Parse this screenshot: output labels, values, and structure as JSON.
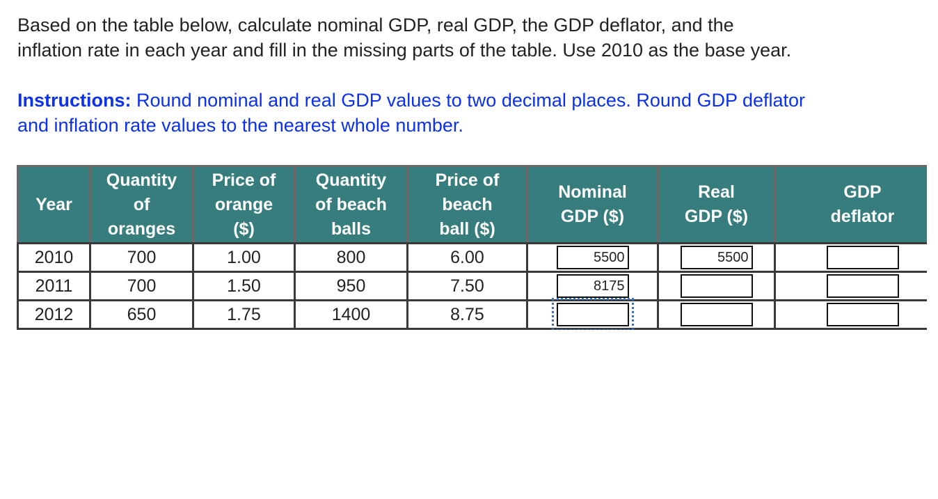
{
  "question": {
    "line1": "Based on the table below, calculate nominal GDP, real GDP, the GDP deflator, and the",
    "line2": "inflation rate in each year and fill in the missing parts of the table. Use 2010 as the base year."
  },
  "instructions": {
    "label": "Instructions:",
    "line1": " Round nominal and real GDP values to two decimal places. Round GDP deflator",
    "line2": "and inflation rate values to the nearest whole number."
  },
  "colors": {
    "header_bg": "#387d7e",
    "instruction_text": "#0b30f0",
    "focus_outline": "#3d72b8"
  },
  "table": {
    "headers": [
      [
        "Year"
      ],
      [
        "Quantity",
        "of",
        "oranges"
      ],
      [
        "Price of",
        "orange",
        "($)"
      ],
      [
        "Quantity",
        "of beach",
        "balls"
      ],
      [
        "Price of",
        "beach",
        "ball ($)"
      ],
      [
        "Nominal",
        "GDP ($)"
      ],
      [
        "Real",
        "GDP ($)"
      ],
      [
        "GDP",
        "deflator"
      ]
    ],
    "rows": [
      {
        "year": "2010",
        "q_oranges": "700",
        "p_orange": "1.00",
        "q_balls": "800",
        "p_ball": "6.00",
        "nominal": "5500",
        "real": "5500",
        "deflator": ""
      },
      {
        "year": "2011",
        "q_oranges": "700",
        "p_orange": "1.50",
        "q_balls": "950",
        "p_ball": "7.50",
        "nominal": "8175",
        "real": "",
        "deflator": ""
      },
      {
        "year": "2012",
        "q_oranges": "650",
        "p_orange": "1.75",
        "q_balls": "1400",
        "p_ball": "8.75",
        "nominal": "",
        "real": "",
        "deflator": ""
      }
    ]
  }
}
